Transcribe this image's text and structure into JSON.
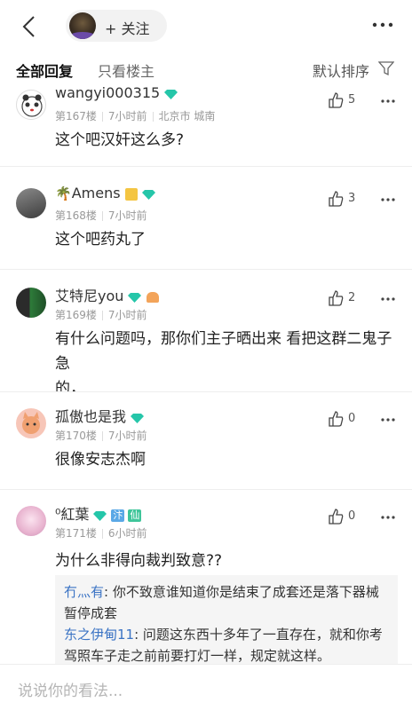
{
  "header": {
    "follow_label": "+ 关注"
  },
  "tabs": {
    "all": "全部回复",
    "op_only": "只看楼主",
    "sort": "默认排序"
  },
  "comments": [
    {
      "username": "wangyi000315",
      "floor": "第167楼",
      "time": "7小时前",
      "location": "北京市 城南",
      "text": "这个吧汉奸这么多?",
      "likes": "5"
    },
    {
      "username": "Amens",
      "floor": "第168楼",
      "time": "7小时前",
      "text": "这个吧药丸了",
      "likes": "3"
    },
    {
      "username": "艾特尼you",
      "floor": "第169楼",
      "time": "7小时前",
      "text_line1": "有什么问题吗，那你们主子晒出来 看把这群二鬼子急",
      "text_line2": "的，",
      "likes": "2"
    },
    {
      "username": "孤傲也是我",
      "floor": "第170楼",
      "time": "7小时前",
      "text": "很像安志杰啊",
      "likes": "0"
    },
    {
      "username": "⁰紅葉",
      "floor": "第171楼",
      "time": "6小时前",
      "text": "为什么非得向裁判致意??",
      "likes": "0",
      "badge1": "汴",
      "badge2": "仙",
      "replies": [
        {
          "name": "冇灬有",
          "line1": ": 你不致意谁知道你是结束了成套还是落下器械",
          "line2": "暂停成套"
        },
        {
          "name": "东之伊甸11",
          "line1": ": 问题这东西十多年了一直存在，就和你考",
          "line2": "驾照车子走之前前要打灯一样，规定就这样。"
        }
      ]
    }
  ],
  "input": {
    "placeholder": "说说你的看法..."
  },
  "colors": {
    "accent_link": "#3a73c4",
    "vip_teal": "#25c6a9",
    "muted": "#999999"
  }
}
